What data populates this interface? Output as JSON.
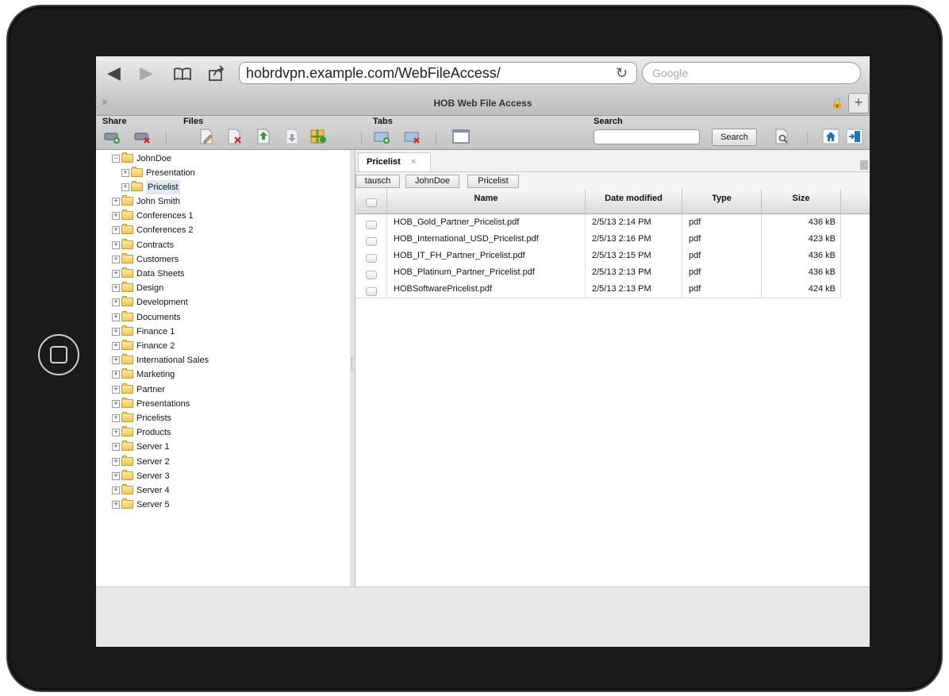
{
  "browser": {
    "url": "hobrdvpn.example.com/WebFileAccess/",
    "search_placeholder": "Google",
    "tab_close": "×",
    "page_title": "HOB Web File Access",
    "new_tab": "+"
  },
  "toolbar": {
    "share_label": "Share",
    "files_label": "Files",
    "tabs_label": "Tabs",
    "search_label": "Search",
    "search_button": "Search",
    "search_value": ""
  },
  "tree": {
    "root": "JohnDoe",
    "root_children": [
      "Presentation",
      "Pricelist"
    ],
    "folders": [
      "John Smith",
      "Conferences 1",
      "Conferences 2",
      "Contracts",
      "Customers",
      "Data Sheets",
      "Design",
      "Development",
      "Documents",
      "Finance 1",
      "Finance 2",
      "International Sales",
      "Marketing",
      "Partner",
      "Presentations",
      "Pricelists",
      "Products",
      "Server 1",
      "Server 2",
      "Server 3",
      "Server 4",
      "Server 5"
    ]
  },
  "doc_tab": {
    "label": "Pricelist",
    "close": "×"
  },
  "breadcrumbs": [
    "tausch",
    "JohnDoe",
    "Pricelist"
  ],
  "grid": {
    "headers": {
      "name": "Name",
      "date": "Date modified",
      "type": "Type",
      "size": "Size"
    },
    "rows": [
      {
        "name": "HOB_Gold_Partner_Pricelist.pdf",
        "date": "2/5/13 2:14 PM",
        "type": "pdf",
        "size": "436 kB"
      },
      {
        "name": "HOB_International_USD_Pricelist.pdf",
        "date": "2/5/13 2:16 PM",
        "type": "pdf",
        "size": "423 kB"
      },
      {
        "name": "HOB_IT_FH_Partner_Pricelist.pdf",
        "date": "2/5/13 2:15 PM",
        "type": "pdf",
        "size": "436 kB"
      },
      {
        "name": "HOB_Platinum_Partner_Pricelist.pdf",
        "date": "2/5/13 2:13 PM",
        "type": "pdf",
        "size": "436 kB"
      },
      {
        "name": "HOBSoftwarePricelist.pdf",
        "date": "2/5/13 2:13 PM",
        "type": "pdf",
        "size": "424 kB"
      }
    ]
  },
  "colors": {
    "bezel": "#1b1b1b",
    "folder": "#f3c552",
    "home_blue": "#1e6fd0"
  }
}
